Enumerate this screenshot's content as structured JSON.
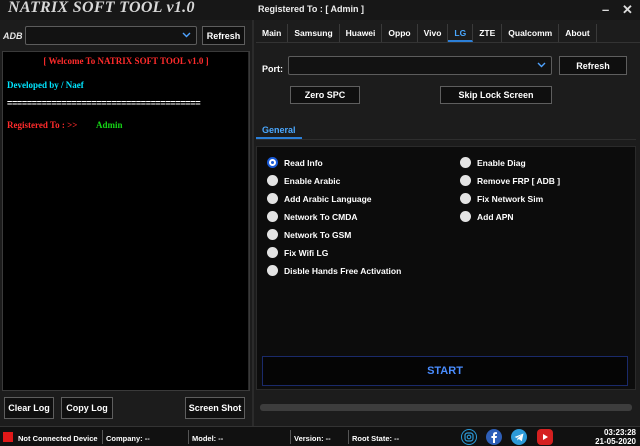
{
  "window": {
    "title": "NATRIX SOFT TOOL v1.0",
    "registered": "Registered To : [ Admin ]",
    "minimize_glyph": "–",
    "close_glyph": "✕"
  },
  "adb": {
    "label": "ADB",
    "selected": "",
    "refresh_label": "Refresh"
  },
  "log": {
    "welcome": "[ Welcome To NATRIX SOFT TOOL v1.0 ]",
    "developed_by": "Developed by /  Naef",
    "separator": "=======================================",
    "registered_to": "Registered To :   >>",
    "registered_name": "Admin"
  },
  "left_buttons": {
    "clear_log": "Clear Log",
    "copy_log": "Copy Log",
    "screen_shot": "Screen Shot"
  },
  "tabs": [
    "Main",
    "Samsung",
    "Huawei",
    "Oppo",
    "Vivo",
    "LG",
    "ZTE",
    "Qualcomm",
    "About"
  ],
  "active_tab": "LG",
  "port": {
    "label": "Port:",
    "selected": "",
    "refresh_label": "Refresh"
  },
  "actions": {
    "zero_spc": "Zero SPC",
    "skip_lock": "Skip Lock Screen"
  },
  "sub_tab": "General",
  "options_left": [
    {
      "label": "Read Info",
      "checked": true
    },
    {
      "label": "Enable Arabic",
      "checked": false
    },
    {
      "label": "Add Arabic Language",
      "checked": false
    },
    {
      "label": "Network To CMDA",
      "checked": false
    },
    {
      "label": "Network To GSM",
      "checked": false
    },
    {
      "label": "Fix Wifi LG",
      "checked": false
    },
    {
      "label": "Disble Hands Free Activation",
      "checked": false
    }
  ],
  "options_right": [
    {
      "label": "Enable Diag",
      "checked": false
    },
    {
      "label": "Remove FRP [ ADB ]",
      "checked": false
    },
    {
      "label": "Fix Network Sim",
      "checked": false
    },
    {
      "label": "Add APN",
      "checked": false
    }
  ],
  "start_label": "START",
  "progress": 0,
  "status": {
    "device": "Not Connected Device",
    "company": "Company: --",
    "model": "Model: --",
    "version": "Version: --",
    "root": "Root State: --",
    "time": "03:23:28",
    "date": "21-05-2020"
  },
  "social_icons": [
    "instagram-icon",
    "facebook-icon",
    "telegram-icon",
    "youtube-icon"
  ],
  "colors": {
    "accent": "#2b7fd8",
    "log_red": "#ff2b2b",
    "log_cyan": "#00e5ff",
    "log_green": "#15d415",
    "status_red": "#e01818"
  }
}
